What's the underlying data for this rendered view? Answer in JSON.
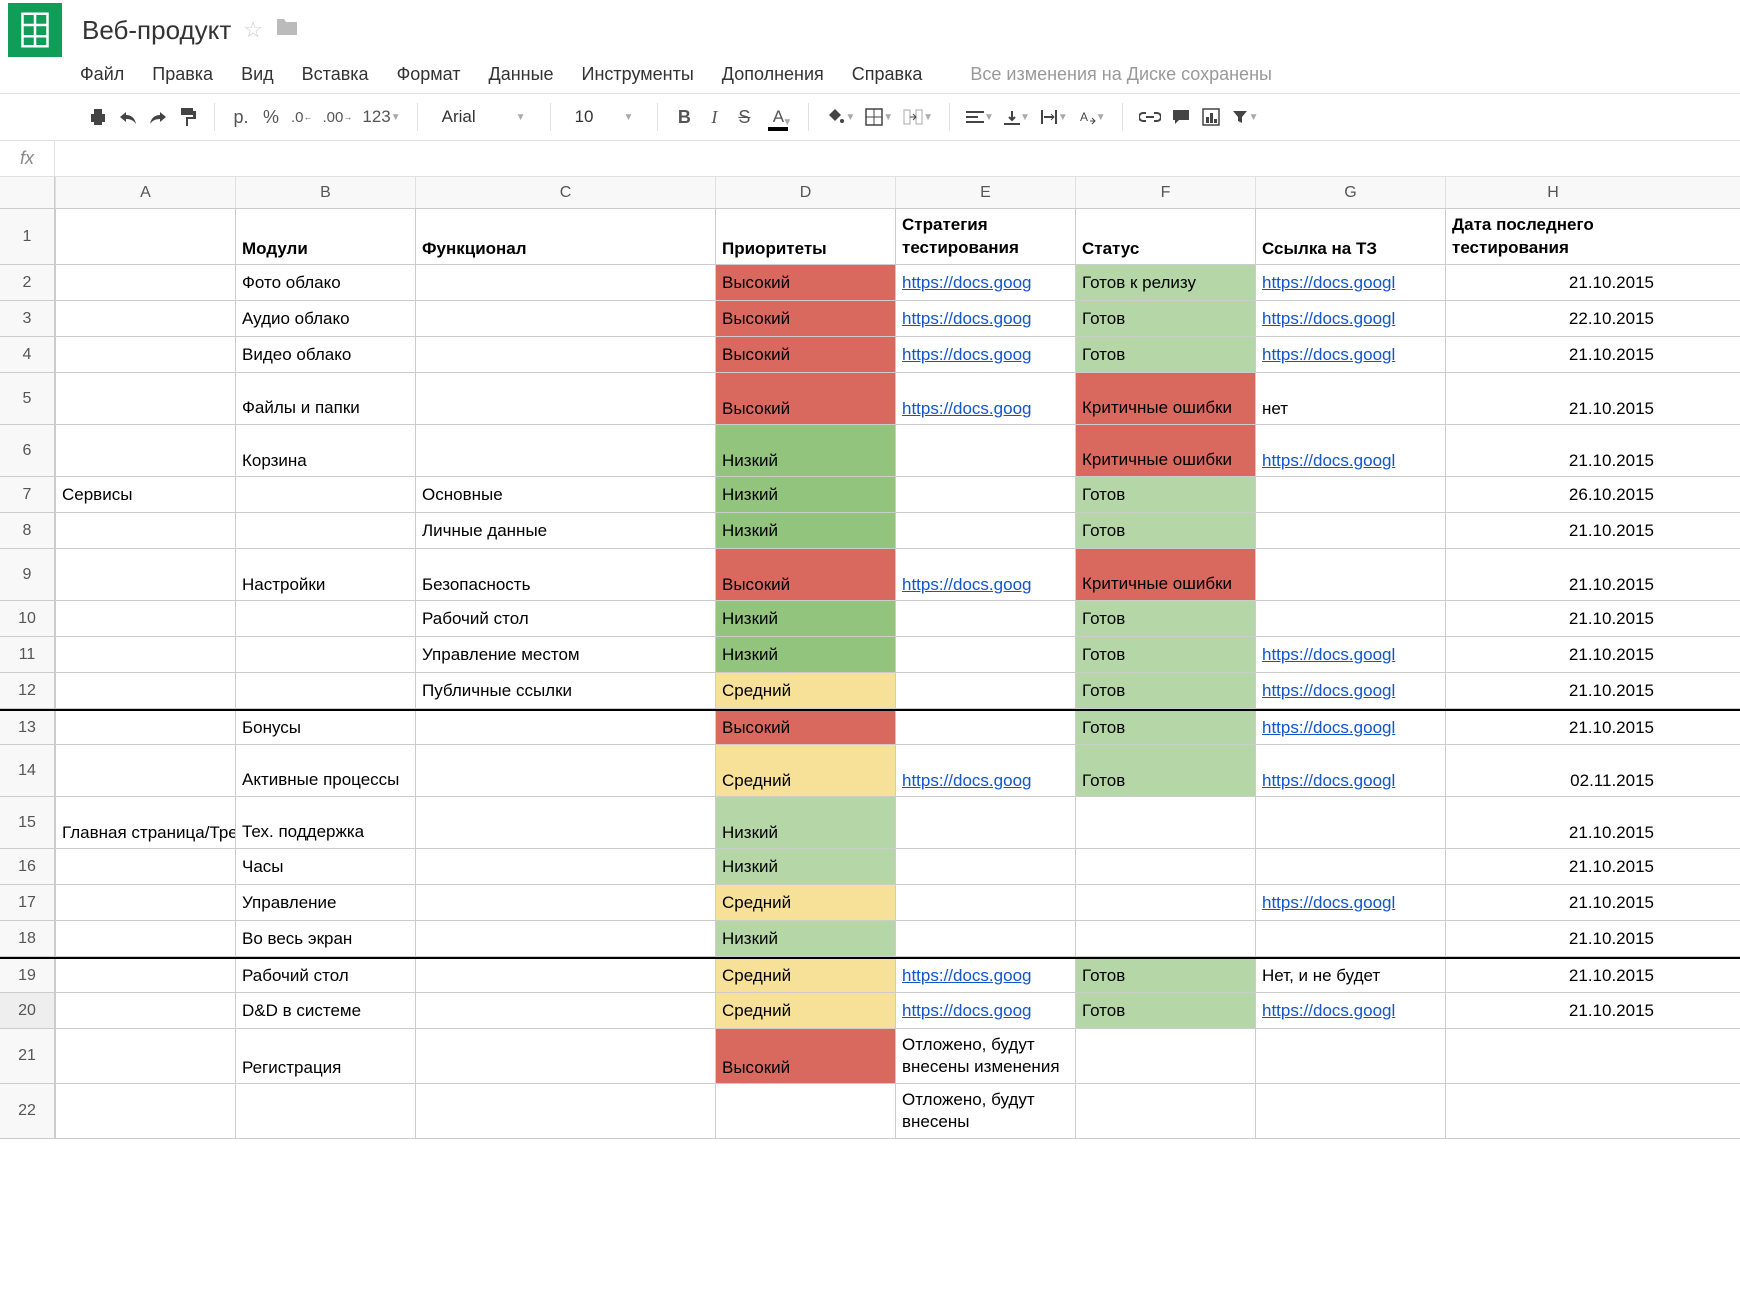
{
  "doc": {
    "title": "Веб-продукт",
    "save_status": "Все изменения на Диске сохранены"
  },
  "menus": [
    "Файл",
    "Правка",
    "Вид",
    "Вставка",
    "Формат",
    "Данные",
    "Инструменты",
    "Дополнения",
    "Справка"
  ],
  "toolbar": {
    "currency": "р.",
    "percent": "%",
    "dec_dec": ".0",
    "dec_inc": ".00",
    "num": "123",
    "font": "Arial",
    "size": "10"
  },
  "fx": "fx",
  "cols": [
    "A",
    "B",
    "C",
    "D",
    "E",
    "F",
    "G",
    "H"
  ],
  "row_header": {
    "a": "",
    "b": "Модули",
    "c": "Функционал",
    "d": "Приоритеты",
    "e": "Стратегия тестирования",
    "f": "Статус",
    "g": "Ссылка на ТЗ",
    "h": "Дата последнего тестирования"
  },
  "sectionA": {
    "r2": "Сервисы",
    "r13": "Главная страница/Трей"
  },
  "rows": [
    {
      "n": 2,
      "b": "Фото облако",
      "c": "",
      "d": "Высокий",
      "dcls": "bg-red",
      "e": "https://docs.goog",
      "f": "Готов к релизу",
      "fcls": "bg-green",
      "g": "https://docs.googl",
      "h": "21.10.2015"
    },
    {
      "n": 3,
      "b": "Аудио облако",
      "c": "",
      "d": "Высокий",
      "dcls": "bg-red",
      "e": "https://docs.goog",
      "f": "Готов",
      "fcls": "bg-green",
      "g": "https://docs.googl",
      "h": "22.10.2015"
    },
    {
      "n": 4,
      "b": "Видео облако",
      "c": "",
      "d": "Высокий",
      "dcls": "bg-red",
      "e": "https://docs.goog",
      "f": "Готов",
      "fcls": "bg-green",
      "g": "https://docs.googl",
      "h": "21.10.2015"
    },
    {
      "n": 5,
      "b": "Файлы и папки",
      "c": "",
      "d": "Высокий",
      "dcls": "bg-red",
      "e": "https://docs.goog",
      "f": "Критичные ошибки",
      "fcls": "bg-red",
      "g": "нет",
      "gcls": "plain",
      "h": "21.10.2015",
      "tall": 1
    },
    {
      "n": 6,
      "b": "Корзина",
      "c": "",
      "d": "Низкий",
      "dcls": "bg-dgreen",
      "e": "",
      "f": "Критичные ошибки",
      "fcls": "bg-red",
      "g": "https://docs.googl",
      "h": "21.10.2015",
      "tall": 1
    },
    {
      "n": 7,
      "b": "",
      "c": "Основные",
      "d": "Низкий",
      "dcls": "bg-dgreen",
      "e": "",
      "f": "Готов",
      "fcls": "bg-green",
      "g": "",
      "h": "26.10.2015"
    },
    {
      "n": 8,
      "b": "",
      "c": "Личные данные",
      "d": "Низкий",
      "dcls": "bg-dgreen",
      "e": "",
      "f": "Готов",
      "fcls": "bg-green",
      "g": "",
      "h": "21.10.2015"
    },
    {
      "n": 9,
      "b": "Настройки",
      "c": "Безопасность",
      "d": "Высокий",
      "dcls": "bg-red",
      "e": "https://docs.goog",
      "f": "Критичные ошибки",
      "fcls": "bg-red",
      "g": "",
      "h": "21.10.2015",
      "tall": 1
    },
    {
      "n": 10,
      "b": "",
      "c": "Рабочий стол",
      "d": "Низкий",
      "dcls": "bg-dgreen",
      "e": "",
      "f": "Готов",
      "fcls": "bg-green",
      "g": "",
      "h": "21.10.2015"
    },
    {
      "n": 11,
      "b": "",
      "c": "Управление местом",
      "d": "Низкий",
      "dcls": "bg-dgreen",
      "e": "",
      "f": "Готов",
      "fcls": "bg-green",
      "g": "https://docs.googl",
      "h": "21.10.2015"
    },
    {
      "n": 12,
      "b": "",
      "c": "Публичные ссылки",
      "d": "Средний",
      "dcls": "bg-yellow",
      "e": "",
      "f": "Готов",
      "fcls": "bg-green",
      "g": "https://docs.googl",
      "h": "21.10.2015"
    },
    {
      "n": 13,
      "b": "Бонусы",
      "c": "",
      "d": "Высокий",
      "dcls": "bg-red",
      "e": "",
      "f": "Готов",
      "fcls": "bg-green",
      "g": "https://docs.googl",
      "h": "21.10.2015",
      "top": 1
    },
    {
      "n": 14,
      "b": "Активные процессы",
      "c": "",
      "d": "Средний",
      "dcls": "bg-yellow",
      "e": "https://docs.goog",
      "f": "Готов",
      "fcls": "bg-green",
      "g": "https://docs.googl",
      "h": "02.11.2015",
      "tall": 1
    },
    {
      "n": 15,
      "b": "Тех. поддержка",
      "c": "",
      "d": "Низкий",
      "dcls": "bg-green",
      "e": "",
      "f": "",
      "fcls": "",
      "g": "",
      "h": "21.10.2015",
      "tall": 1
    },
    {
      "n": 16,
      "b": "Часы",
      "c": "",
      "d": "Низкий",
      "dcls": "bg-green",
      "e": "",
      "f": "",
      "fcls": "",
      "g": "",
      "h": "21.10.2015"
    },
    {
      "n": 17,
      "b": "Управление",
      "c": "",
      "d": "Средний",
      "dcls": "bg-yellow",
      "e": "",
      "f": "",
      "fcls": "",
      "g": "https://docs.googl",
      "h": "21.10.2015"
    },
    {
      "n": 18,
      "b": "Во весь экран",
      "c": "",
      "d": "Низкий",
      "dcls": "bg-green",
      "e": "",
      "f": "",
      "fcls": "",
      "g": "",
      "h": "21.10.2015"
    },
    {
      "n": 19,
      "b": "Рабочий стол",
      "c": "",
      "d": "Средний",
      "dcls": "bg-yellow",
      "e": "https://docs.goog",
      "f": "Готов",
      "fcls": "bg-green",
      "g": "Нет, и не будет",
      "gcls": "plain",
      "h": "21.10.2015",
      "top": 1
    },
    {
      "n": 20,
      "b": "D&D в системе",
      "c": "",
      "d": "Средний",
      "dcls": "bg-yellow",
      "e": "https://docs.goog",
      "f": "Готов",
      "fcls": "bg-green",
      "g": "https://docs.googl",
      "h": "21.10.2015"
    },
    {
      "n": 21,
      "b": "Регистрация",
      "c": "",
      "d": "Высокий",
      "dcls": "bg-red",
      "e": "Отложено, будут внесены изменения",
      "ecls": "plain",
      "f": "",
      "fcls": "",
      "g": "",
      "h": "",
      "tall": 1
    },
    {
      "n": 22,
      "b": "",
      "c": "",
      "d": "",
      "dcls": "",
      "e": "Отложено, будут внесены",
      "ecls": "plain",
      "f": "",
      "fcls": "",
      "g": "",
      "h": ""
    }
  ]
}
